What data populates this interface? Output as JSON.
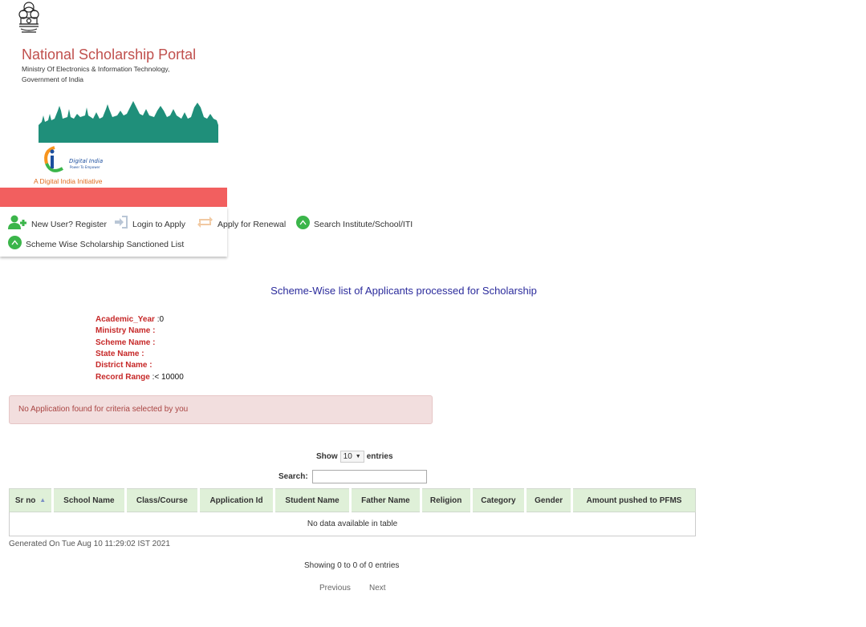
{
  "header": {
    "portal_title": "National Scholarship Portal",
    "ministry_line1": "Ministry Of Electronics & Information Technology,",
    "ministry_line2": "Government of India",
    "digital_india_name": "Digital India",
    "digital_india_slogan": "Power To Empower",
    "digital_india_tag": "A Digital India Initiative"
  },
  "nav": {
    "items": [
      {
        "label": "New User? Register",
        "icon": "add-user-icon"
      },
      {
        "label": "Login to Apply",
        "icon": "login-icon"
      },
      {
        "label": "Apply for Renewal",
        "icon": "renew-icon"
      },
      {
        "label": "Search Institute/School/ITI",
        "icon": "chevron-up-circle-icon"
      },
      {
        "label": "Scheme Wise Scholarship Sanctioned List",
        "icon": "chevron-up-circle-icon"
      }
    ]
  },
  "page": {
    "heading": "Scheme-Wise list of Applicants processed for Scholarship"
  },
  "criteria": {
    "academic_year_label": "Academic_Year",
    "academic_year_sep": " :",
    "academic_year_value": "0",
    "ministry_label": "Ministry Name :",
    "scheme_label": "Scheme Name :",
    "state_label": "State Name :",
    "district_label": "District Name :",
    "record_range_label": "Record Range",
    "record_range_sep": " :",
    "record_range_value": "< 10000"
  },
  "alert": {
    "message": "No Application found for criteria selected by you"
  },
  "table_controls": {
    "show_label": "Show",
    "entries_label": "entries",
    "page_length": "10",
    "search_label": "Search:",
    "search_value": ""
  },
  "table": {
    "columns": [
      "Sr no",
      "School Name",
      "Class/Course",
      "Application Id",
      "Student Name",
      "Father Name",
      "Religion",
      "Category",
      "Gender",
      "Amount pushed to PFMS"
    ],
    "empty_message": "No data available in table"
  },
  "footer": {
    "generated": "Generated On Tue Aug 10 11:29:02 IST 2021",
    "showing": "Showing 0 to 0 of 0 entries",
    "previous": "Previous",
    "next": "Next"
  },
  "colors": {
    "title": "#c0504d",
    "red_bar": "#f25f5f",
    "heading_blue": "#2b2b9c",
    "criteria_label": "#c62828",
    "alert_bg": "#f2dede",
    "table_header_bg": "#dff0d8",
    "nav_icon_green": "#3bb54a"
  }
}
